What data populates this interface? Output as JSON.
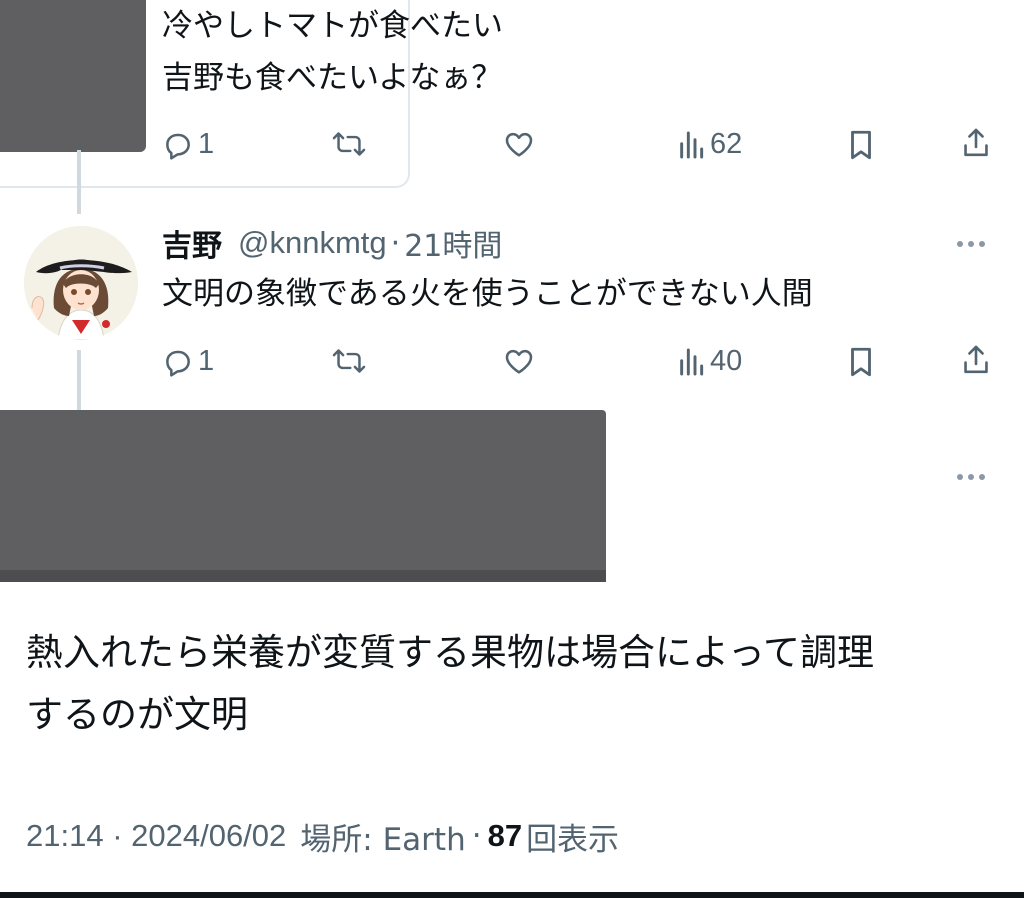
{
  "tweet1": {
    "lines": [
      "冷やしトマトが食べたい",
      "吉野も食べたいよなぁ？"
    ],
    "replies": "1",
    "views": "62",
    "icons": [
      "reply-icon",
      "retweet-icon",
      "like-icon",
      "views-icon",
      "bookmark-icon",
      "share-icon"
    ]
  },
  "tweet2": {
    "name": "吉野",
    "handle": "@knnkmtg",
    "sep": "·",
    "time": "21時間",
    "text": "文明の象徴である火を使うことができない人間",
    "replies": "1",
    "views": "40"
  },
  "main": {
    "text_line1": "熱入れたら栄養が変質する果物は場合によって調理",
    "text_line2": "するのが文明",
    "timestamp": "21:14 · 2024/06/02",
    "location_label": "場所: Earth",
    "sep": "·",
    "view_count": "87",
    "view_label": "回表示"
  },
  "colors": {
    "text": "#0f1419",
    "muted": "#536471",
    "redacted": "#5f5f61",
    "thread_line": "#cfd9de"
  }
}
